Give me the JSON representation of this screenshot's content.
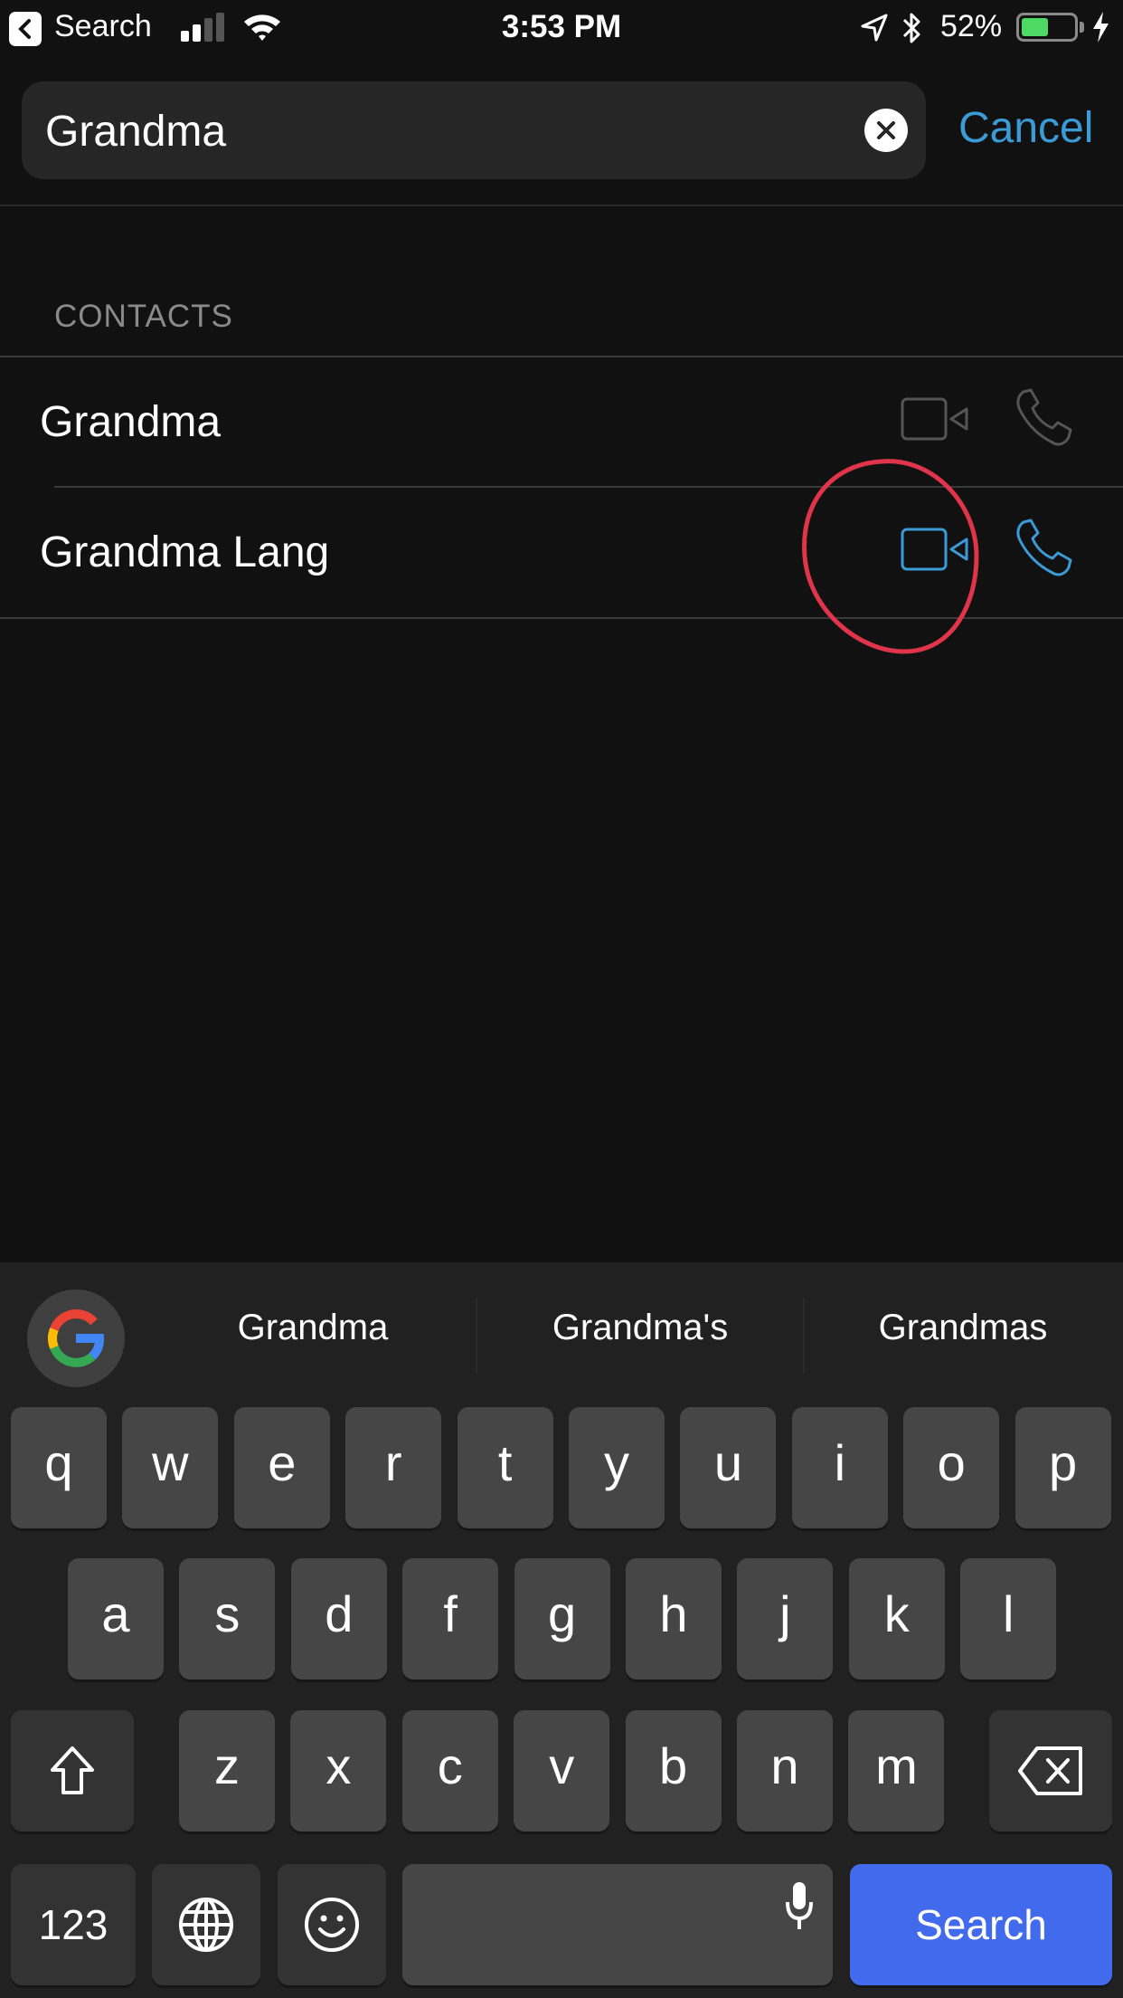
{
  "status_bar": {
    "back_app": "Search",
    "time": "3:53 PM",
    "battery_percent": "52%",
    "battery_level": 0.52,
    "signal_bars": 2,
    "signal_max": 4,
    "icons": [
      "back-chevron-icon",
      "signal-icon",
      "wifi-icon",
      "location-arrow-icon",
      "bluetooth-icon",
      "battery-icon",
      "charging-bolt-icon"
    ],
    "battery_color": "#4cd964"
  },
  "search": {
    "value": "Grandma",
    "clear_icon": "clear-circle-x-icon",
    "cancel_label": "Cancel"
  },
  "contacts": {
    "section_title": "CONTACTS",
    "items": [
      {
        "name": "Grandma",
        "actions_enabled": false,
        "video_icon": "video-camera-icon",
        "phone_icon": "phone-icon"
      },
      {
        "name": "Grandma Lang",
        "actions_enabled": true,
        "video_icon": "video-camera-icon",
        "phone_icon": "phone-icon"
      }
    ]
  },
  "annotation": {
    "type": "hand-drawn-circle",
    "target": "Grandma Lang video call button",
    "color": "#e0344a"
  },
  "keyboard": {
    "suggestions": [
      "Grandma",
      "Grandma's",
      "Grandmas"
    ],
    "google_icon": "google-g-icon",
    "row1": [
      "q",
      "w",
      "e",
      "r",
      "t",
      "y",
      "u",
      "i",
      "o",
      "p"
    ],
    "row2": [
      "a",
      "s",
      "d",
      "f",
      "g",
      "h",
      "j",
      "k",
      "l"
    ],
    "row3": [
      "z",
      "x",
      "c",
      "v",
      "b",
      "n",
      "m"
    ],
    "shift_icon": "shift-arrow-icon",
    "delete_icon": "backspace-icon",
    "numbers_label": "123",
    "globe_icon": "globe-icon",
    "emoji_icon": "emoji-smiley-icon",
    "mic_icon": "microphone-icon",
    "space_label": "",
    "action_label": "Search"
  },
  "colors": {
    "accent": "#3b9bd6",
    "disabled_icon": "#555555",
    "background": "#111111",
    "keyboard_bg": "#212121",
    "key_bg": "#464646",
    "search_key": "#416bec"
  }
}
